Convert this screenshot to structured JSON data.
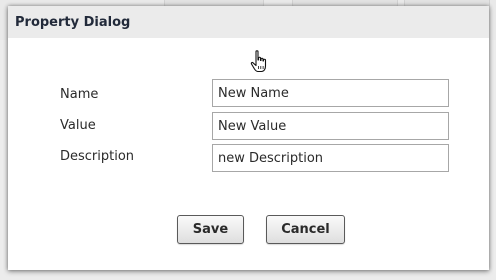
{
  "dialog": {
    "title": "Property Dialog"
  },
  "fields": [
    {
      "label": "Name",
      "value": "New Name"
    },
    {
      "label": "Value",
      "value": "New Value"
    },
    {
      "label": "Description",
      "value": "new Description"
    }
  ],
  "buttons": {
    "save_label": "Save",
    "cancel_label": "Cancel"
  },
  "cursor": {
    "icon": "hand-pointer-icon"
  }
}
